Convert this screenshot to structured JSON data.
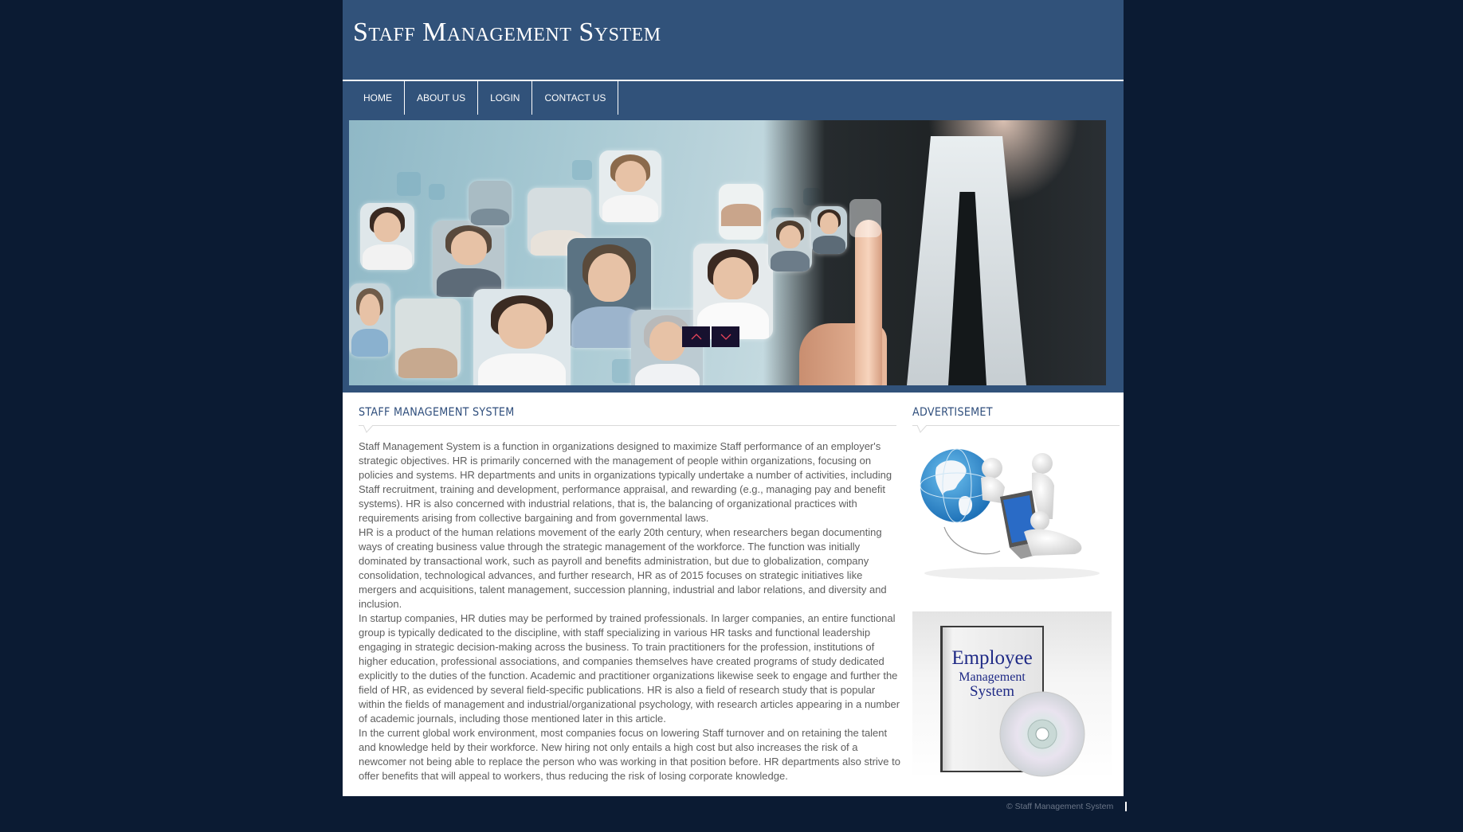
{
  "header": {
    "site_title": "Staff Management System"
  },
  "nav": {
    "items": [
      {
        "label": "HOME"
      },
      {
        "label": "ABOUT US"
      },
      {
        "label": "LOGIN"
      },
      {
        "label": "CONTACT US"
      }
    ]
  },
  "banner": {
    "prev_icon": "chevron-up-icon",
    "next_icon": "chevron-down-icon",
    "arrow_color": "#e8445a",
    "button_bg": "#17112f"
  },
  "main": {
    "title": "STAFF MANAGEMENT SYSTEM",
    "paragraphs": [
      "Staff Management System is a function in organizations designed to maximize Staff performance of an employer's strategic objectives. HR is primarily concerned with the management of people within organizations, focusing on policies and systems. HR departments and units in organizations typically undertake a number of activities, including Staff recruitment, training and development, performance appraisal, and rewarding (e.g., managing pay and benefit systems). HR is also concerned with industrial relations, that is, the balancing of organizational practices with requirements arising from collective bargaining and from governmental laws.",
      "HR is a product of the human relations movement of the early 20th century, when researchers began documenting ways of creating business value through the strategic management of the workforce. The function was initially dominated by transactional work, such as payroll and benefits administration, but due to globalization, company consolidation, technological advances, and further research, HR as of 2015 focuses on strategic initiatives like mergers and acquisitions, talent management, succession planning, industrial and labor relations, and diversity and inclusion.",
      "In startup companies, HR duties may be performed by trained professionals. In larger companies, an entire functional group is typically dedicated to the discipline, with staff specializing in various HR tasks and functional leadership engaging in strategic decision-making across the business. To train practitioners for the profession, institutions of higher education, professional associations, and companies themselves have created programs of study dedicated explicitly to the duties of the function. Academic and practitioner organizations likewise seek to engage and further the field of HR, as evidenced by several field-specific publications. HR is also a field of research study that is popular within the fields of management and industrial/organizational psychology, with research articles appearing in a number of academic journals, including those mentioned later in this article.",
      "In the current global work environment, most companies focus on lowering Staff turnover and on retaining the talent and knowledge held by their workforce. New hiring not only entails a high cost but also increases the risk of a newcomer not being able to replace the person who was working in that position before. HR departments also strive to offer benefits that will appeal to workers, thus reducing the risk of losing corporate knowledge."
    ]
  },
  "sidebar": {
    "title": "ADVERTISEMET",
    "ads": [
      {
        "image": "globe-laptop-people-illustration"
      },
      {
        "image": "employee-management-software-box",
        "box_text": [
          "Employee",
          "Management",
          "System"
        ]
      }
    ]
  },
  "footer": {
    "copyright": "© Staff Management System"
  },
  "colors": {
    "page_bg": "#0b1b33",
    "header_bg": "#31527a",
    "heading": "#2f4e7c",
    "body_text": "#5e5e5e"
  }
}
